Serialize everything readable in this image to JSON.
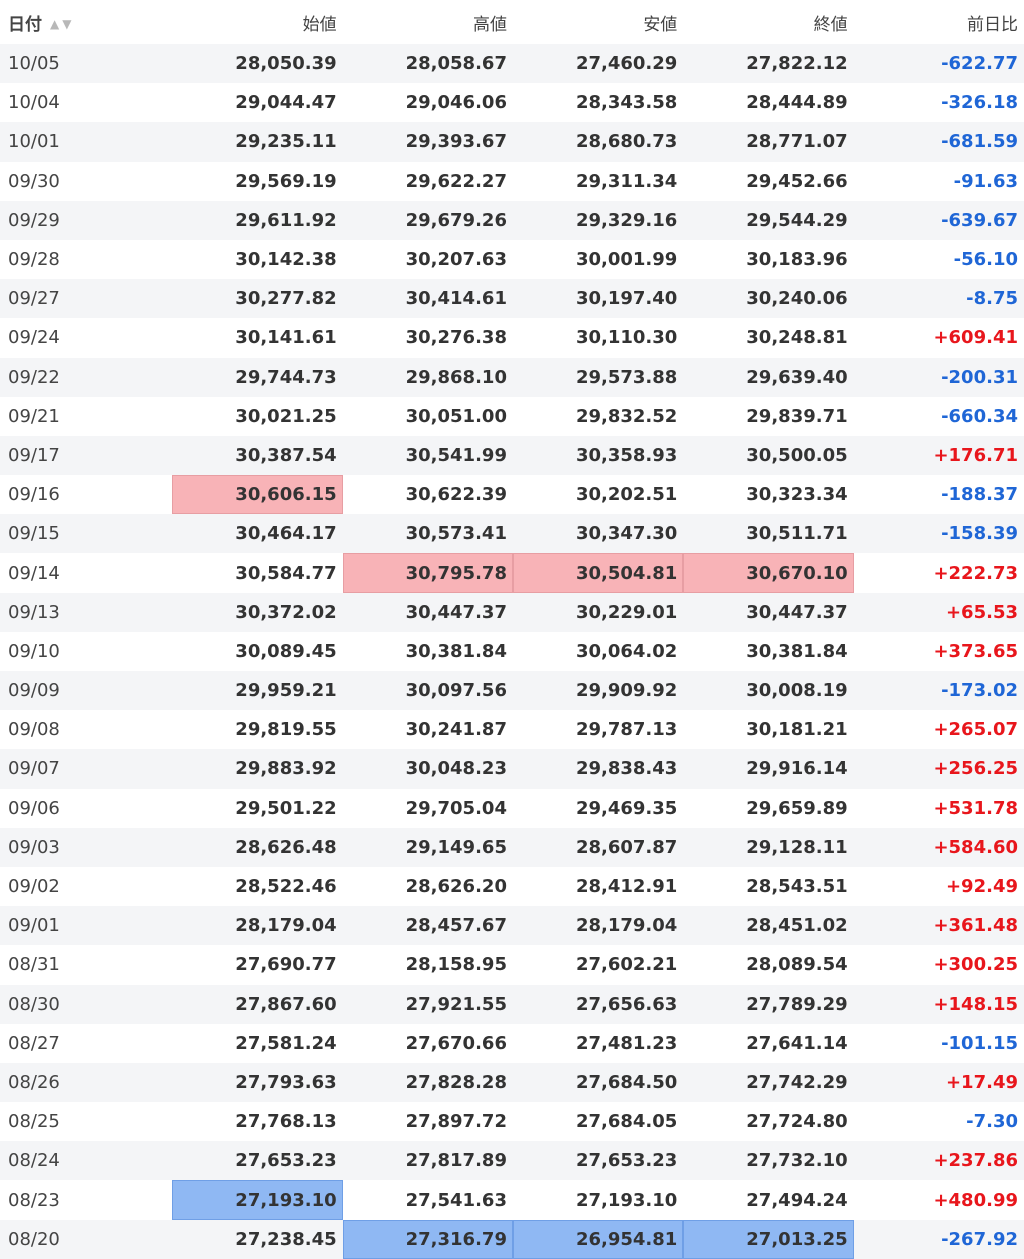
{
  "colors": {
    "positive": "#e8161c",
    "negative": "#1f66d6",
    "highlight_high": "#f8b3b7",
    "highlight_low": "#8fb8f3"
  },
  "headers": {
    "date": "日付",
    "open": "始値",
    "high": "高値",
    "low": "安値",
    "close": "終値",
    "change": "前日比",
    "sort_icon": "sort-up-down-icon"
  },
  "rows": [
    {
      "date": "10/05",
      "open": "28,050.39",
      "high": "28,058.67",
      "low": "27,460.29",
      "close": "27,822.12",
      "change": "-622.77"
    },
    {
      "date": "10/04",
      "open": "29,044.47",
      "high": "29,046.06",
      "low": "28,343.58",
      "close": "28,444.89",
      "change": "-326.18"
    },
    {
      "date": "10/01",
      "open": "29,235.11",
      "high": "29,393.67",
      "low": "28,680.73",
      "close": "28,771.07",
      "change": "-681.59"
    },
    {
      "date": "09/30",
      "open": "29,569.19",
      "high": "29,622.27",
      "low": "29,311.34",
      "close": "29,452.66",
      "change": "-91.63"
    },
    {
      "date": "09/29",
      "open": "29,611.92",
      "high": "29,679.26",
      "low": "29,329.16",
      "close": "29,544.29",
      "change": "-639.67"
    },
    {
      "date": "09/28",
      "open": "30,142.38",
      "high": "30,207.63",
      "low": "30,001.99",
      "close": "30,183.96",
      "change": "-56.10"
    },
    {
      "date": "09/27",
      "open": "30,277.82",
      "high": "30,414.61",
      "low": "30,197.40",
      "close": "30,240.06",
      "change": "-8.75"
    },
    {
      "date": "09/24",
      "open": "30,141.61",
      "high": "30,276.38",
      "low": "30,110.30",
      "close": "30,248.81",
      "change": "+609.41"
    },
    {
      "date": "09/22",
      "open": "29,744.73",
      "high": "29,868.10",
      "low": "29,573.88",
      "close": "29,639.40",
      "change": "-200.31"
    },
    {
      "date": "09/21",
      "open": "30,021.25",
      "high": "30,051.00",
      "low": "29,832.52",
      "close": "29,839.71",
      "change": "-660.34"
    },
    {
      "date": "09/17",
      "open": "30,387.54",
      "high": "30,541.99",
      "low": "30,358.93",
      "close": "30,500.05",
      "change": "+176.71"
    },
    {
      "date": "09/16",
      "open": "30,606.15",
      "high": "30,622.39",
      "low": "30,202.51",
      "close": "30,323.34",
      "change": "-188.37",
      "hl": {
        "open": "high"
      }
    },
    {
      "date": "09/15",
      "open": "30,464.17",
      "high": "30,573.41",
      "low": "30,347.30",
      "close": "30,511.71",
      "change": "-158.39"
    },
    {
      "date": "09/14",
      "open": "30,584.77",
      "high": "30,795.78",
      "low": "30,504.81",
      "close": "30,670.10",
      "change": "+222.73",
      "hl": {
        "high": "high",
        "low": "high",
        "close": "high"
      }
    },
    {
      "date": "09/13",
      "open": "30,372.02",
      "high": "30,447.37",
      "low": "30,229.01",
      "close": "30,447.37",
      "change": "+65.53"
    },
    {
      "date": "09/10",
      "open": "30,089.45",
      "high": "30,381.84",
      "low": "30,064.02",
      "close": "30,381.84",
      "change": "+373.65"
    },
    {
      "date": "09/09",
      "open": "29,959.21",
      "high": "30,097.56",
      "low": "29,909.92",
      "close": "30,008.19",
      "change": "-173.02"
    },
    {
      "date": "09/08",
      "open": "29,819.55",
      "high": "30,241.87",
      "low": "29,787.13",
      "close": "30,181.21",
      "change": "+265.07"
    },
    {
      "date": "09/07",
      "open": "29,883.92",
      "high": "30,048.23",
      "low": "29,838.43",
      "close": "29,916.14",
      "change": "+256.25"
    },
    {
      "date": "09/06",
      "open": "29,501.22",
      "high": "29,705.04",
      "low": "29,469.35",
      "close": "29,659.89",
      "change": "+531.78"
    },
    {
      "date": "09/03",
      "open": "28,626.48",
      "high": "29,149.65",
      "low": "28,607.87",
      "close": "29,128.11",
      "change": "+584.60"
    },
    {
      "date": "09/02",
      "open": "28,522.46",
      "high": "28,626.20",
      "low": "28,412.91",
      "close": "28,543.51",
      "change": "+92.49"
    },
    {
      "date": "09/01",
      "open": "28,179.04",
      "high": "28,457.67",
      "low": "28,179.04",
      "close": "28,451.02",
      "change": "+361.48"
    },
    {
      "date": "08/31",
      "open": "27,690.77",
      "high": "28,158.95",
      "low": "27,602.21",
      "close": "28,089.54",
      "change": "+300.25"
    },
    {
      "date": "08/30",
      "open": "27,867.60",
      "high": "27,921.55",
      "low": "27,656.63",
      "close": "27,789.29",
      "change": "+148.15"
    },
    {
      "date": "08/27",
      "open": "27,581.24",
      "high": "27,670.66",
      "low": "27,481.23",
      "close": "27,641.14",
      "change": "-101.15"
    },
    {
      "date": "08/26",
      "open": "27,793.63",
      "high": "27,828.28",
      "low": "27,684.50",
      "close": "27,742.29",
      "change": "+17.49"
    },
    {
      "date": "08/25",
      "open": "27,768.13",
      "high": "27,897.72",
      "low": "27,684.05",
      "close": "27,724.80",
      "change": "-7.30"
    },
    {
      "date": "08/24",
      "open": "27,653.23",
      "high": "27,817.89",
      "low": "27,653.23",
      "close": "27,732.10",
      "change": "+237.86"
    },
    {
      "date": "08/23",
      "open": "27,193.10",
      "high": "27,541.63",
      "low": "27,193.10",
      "close": "27,494.24",
      "change": "+480.99",
      "hl": {
        "open": "low"
      }
    },
    {
      "date": "08/20",
      "open": "27,238.45",
      "high": "27,316.79",
      "low": "26,954.81",
      "close": "27,013.25",
      "change": "-267.92",
      "hl": {
        "high": "low",
        "low": "low",
        "close": "low"
      }
    }
  ]
}
